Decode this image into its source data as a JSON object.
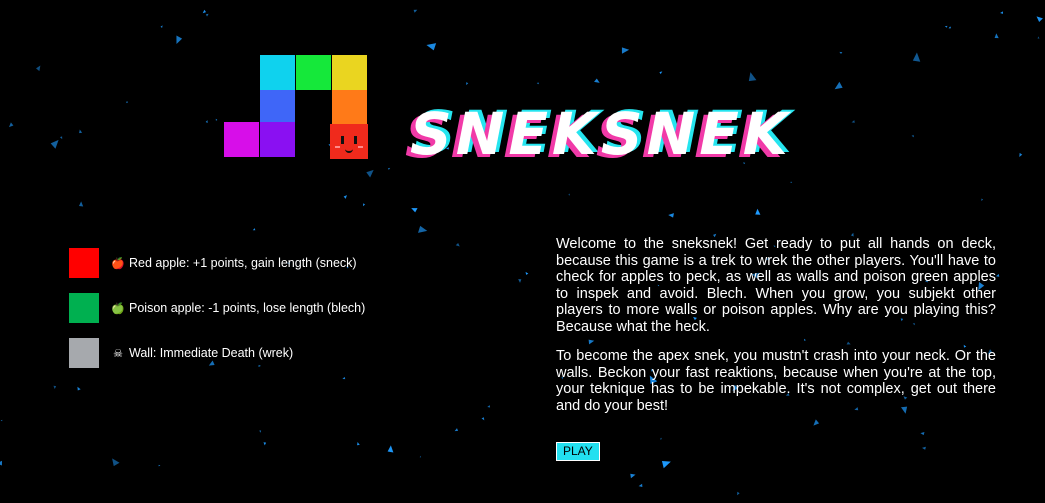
{
  "game": {
    "title": "SNEKSNEK"
  },
  "legend": {
    "items": [
      {
        "label": "Red apple: +1 points, gain length (sneck)",
        "color": "#ff0000",
        "icon": "red-apple-icon",
        "glyph": "🍎",
        "glyph_color": "#e02020"
      },
      {
        "label": "Poison apple: -1 points, lose length (blech)",
        "color": "#00b050",
        "icon": "green-apple-icon",
        "glyph": "🍏",
        "glyph_color": "#6fcf2f"
      },
      {
        "label": "Wall: Immediate Death (wrek)",
        "color": "#a6a9ad",
        "icon": "skull-crossbones-icon",
        "glyph": "☠",
        "glyph_color": "#ffffff"
      }
    ]
  },
  "description": {
    "paragraph1": "Welcome to the sneksnek! Get ready to put all hands on deck, because this game is a trek to wrek the other players. You'll have to check for apples to peck, as well as walls and poison green apples to inspek and avoid. Blech. When you grow, you subjekt other players to more walls or poison apples. Why are you playing this? Because what the heck.",
    "paragraph2": "To become the apex snek, you mustn't crash into your neck. Or the walls. Beckon your fast reaktions, because when you're at the top, your teknique has to be impekable. It's not complex, get out there and do your best!"
  },
  "play_button": {
    "label": "PLAY"
  },
  "colors": {
    "background": "#000000",
    "star": "#1e9bff",
    "play_button": "#22e0f0",
    "title_shadow_pink": "#f13aa8",
    "title_shadow_cyan": "#25e5ef"
  }
}
